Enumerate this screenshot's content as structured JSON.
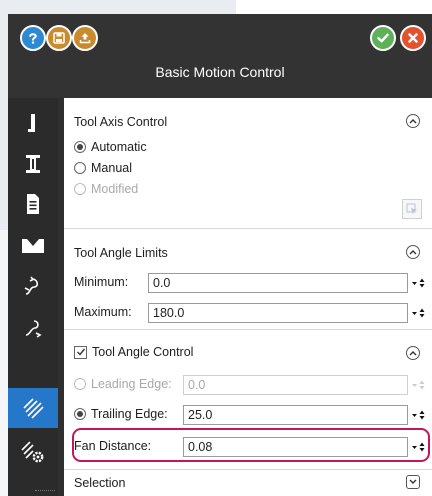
{
  "window": {
    "title": "Basic Motion Control"
  },
  "toolbar": {
    "buttons": [
      {
        "name": "help",
        "icon": "question-icon"
      },
      {
        "name": "save",
        "icon": "floppy-icon"
      },
      {
        "name": "export",
        "icon": "upload-icon"
      },
      {
        "name": "ok",
        "icon": "check-icon"
      },
      {
        "name": "cancel",
        "icon": "close-icon"
      }
    ]
  },
  "sidebar": {
    "items": [
      {
        "icon": "tool-icon",
        "active": false
      },
      {
        "icon": "holder-icon",
        "active": false
      },
      {
        "icon": "document-icon",
        "active": false
      },
      {
        "icon": "pocket-icon",
        "active": false
      },
      {
        "icon": "link-in-icon",
        "active": false
      },
      {
        "icon": "link-out-icon",
        "active": false
      },
      {
        "icon": "motion-lines-icon",
        "active": true
      },
      {
        "icon": "motion-settings-icon",
        "active": false
      }
    ]
  },
  "tool_axis_control": {
    "title": "Tool Axis Control",
    "options": [
      {
        "label": "Automatic",
        "selected": true,
        "enabled": true
      },
      {
        "label": "Manual",
        "selected": false,
        "enabled": true
      },
      {
        "label": "Modified",
        "selected": false,
        "enabled": false
      }
    ]
  },
  "tool_angle_limits": {
    "title": "Tool Angle Limits",
    "minimum": {
      "label": "Minimum:",
      "value": "0.0"
    },
    "maximum": {
      "label": "Maximum:",
      "value": "180.0"
    }
  },
  "tool_angle_control": {
    "title": "Tool Angle Control",
    "checked": true,
    "leading_edge": {
      "label": "Leading Edge:",
      "value": "0.0",
      "selected": false,
      "enabled": false
    },
    "trailing_edge": {
      "label": "Trailing Edge:",
      "value": "25.0",
      "selected": true,
      "enabled": true
    },
    "fan_distance": {
      "label": "Fan Distance:",
      "value": "0.08"
    }
  },
  "selection": {
    "title": "Selection"
  },
  "colors": {
    "accent": "#2577c9",
    "highlight": "#c2185b",
    "ok": "#5fb05c",
    "cancel": "#e3512d"
  }
}
